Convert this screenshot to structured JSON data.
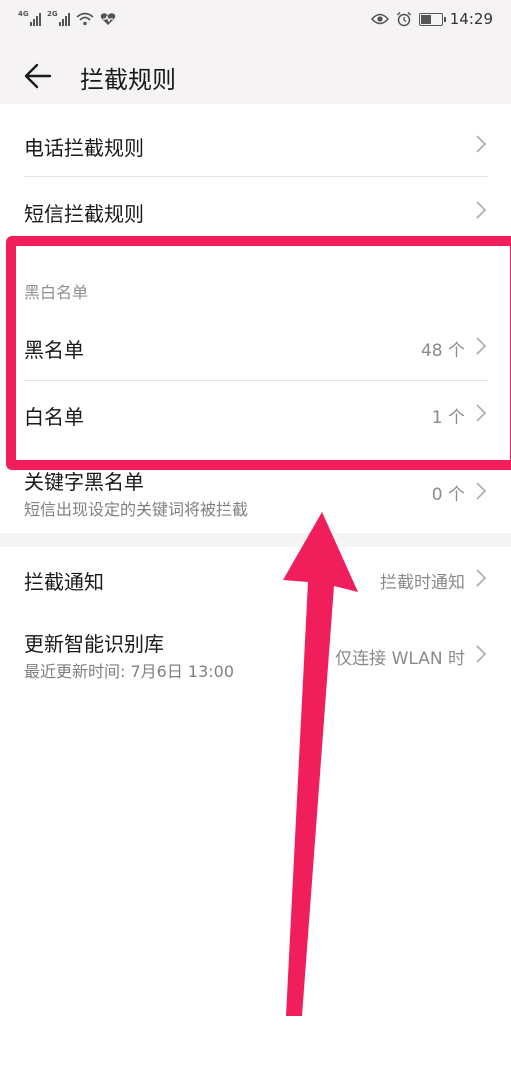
{
  "status_bar": {
    "sim1": "4G",
    "sim2": "2G",
    "time": "14:29",
    "battery_level": 0.55
  },
  "header": {
    "title": "拦截规则",
    "back_icon": "arrow-left-icon"
  },
  "rows": {
    "call_rules": {
      "label": "电话拦截规则"
    },
    "sms_rules": {
      "label": "短信拦截规则"
    },
    "blackwhite_section": "黑白名单",
    "blacklist": {
      "label": "黑名单",
      "value": "48 个"
    },
    "whitelist": {
      "label": "白名单",
      "value": "1 个"
    },
    "keyword_blacklist": {
      "label": "关键字黑名单",
      "sub": "短信出现设定的关键词将被拦截",
      "value": "0 个"
    },
    "intercept_notify": {
      "label": "拦截通知",
      "value": "拦截时通知"
    },
    "update_library": {
      "label": "更新智能识别库",
      "sub": "最近更新时间: 7月6日 13:00",
      "value": "仅连接 WLAN 时"
    }
  },
  "colors": {
    "highlight": "#f01f5c",
    "background": "#ffffff",
    "header_bg": "#f6f3f5"
  }
}
